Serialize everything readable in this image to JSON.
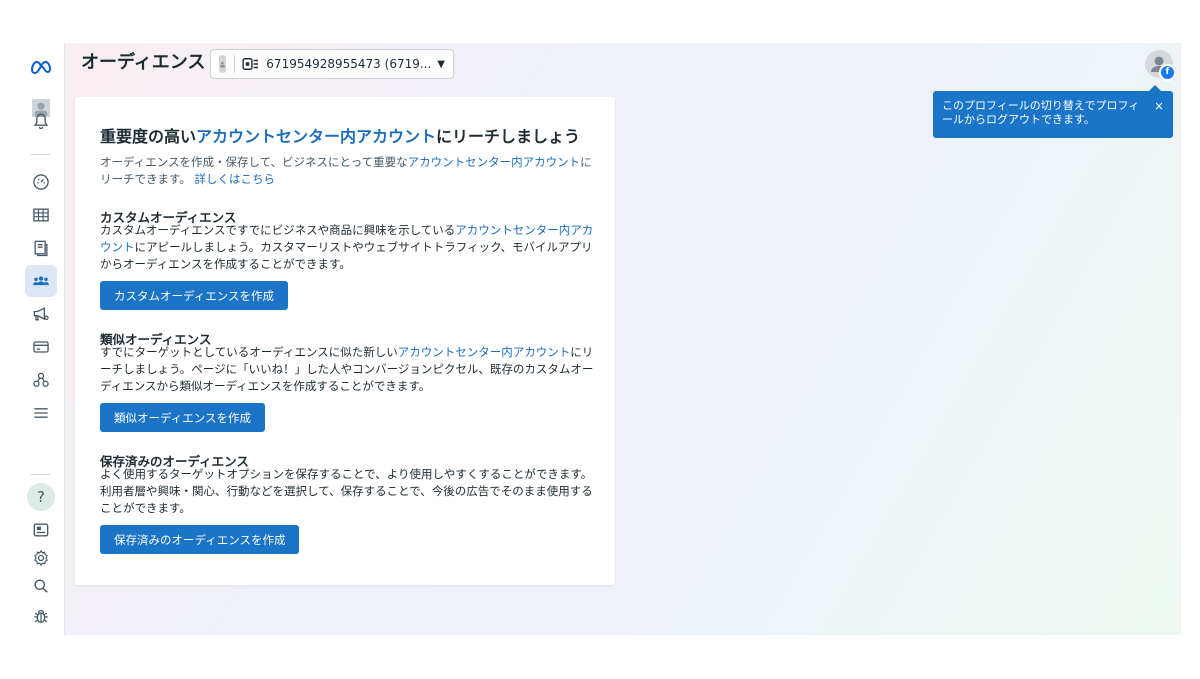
{
  "header": {
    "title": "オーディエンス",
    "account_id": "671954928955473 (6719..."
  },
  "tooltip": {
    "text": "このプロフィールの切り替えでプロフィールからログアウトできます。",
    "close": "×"
  },
  "rail": {
    "help": "?"
  },
  "card": {
    "title_pre": "重要度の高い",
    "title_link": "アカウントセンター内アカウント",
    "title_post": "にリーチしましょう",
    "desc_pre": "オーディエンスを作成・保存して、ビジネスにとって重要な",
    "desc_link": "アカウントセンター内アカウント",
    "desc_mid": "にリーチできます。",
    "desc_learn_more": "詳しくはこちら",
    "custom": {
      "title": "カスタムオーディエンス",
      "body_pre": "カスタムオーディエンスですでにビジネスや商品に興味を示している",
      "body_link": "アカウントセンター内アカウント",
      "body_post": "にアピールしましょう。カスタマーリストやウェブサイトトラフィック、モバイルアプリからオーディエンスを作成することができます。",
      "button": "カスタムオーディエンスを作成"
    },
    "lookalike": {
      "title": "類似オーディエンス",
      "body_pre": "すでにターゲットとしているオーディエンスに似た新しい",
      "body_link": "アカウントセンター内アカウント",
      "body_post": "にリーチしましょう。ページに「いいね！」した人やコンバージョンピクセル、既存のカスタムオーディエンスから類似オーディエンスを作成することができます。",
      "button": "類似オーディエンスを作成"
    },
    "saved": {
      "title": "保存済みのオーディエンス",
      "body": "よく使用するターゲットオプションを保存することで、より使用しやすくすることができます。利用者層や興味・関心、行動などを選択して、保存することで、今後の広告でそのまま使用することができます。",
      "button": "保存済みのオーディエンスを作成"
    }
  },
  "colors": {
    "primary_button": "#1b74c6",
    "link": "#1a6dbd",
    "tooltip": "#1a75c9",
    "active_nav": "#dbe7f4"
  }
}
